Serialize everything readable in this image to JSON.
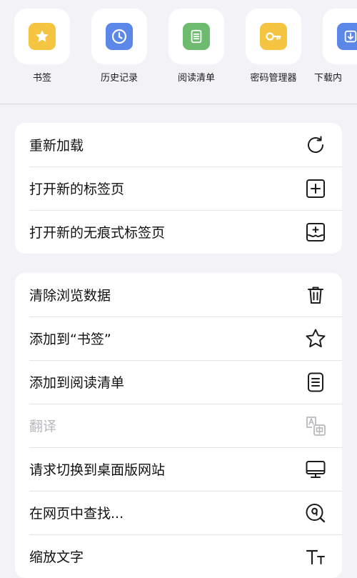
{
  "quick_actions": [
    {
      "label": "书签",
      "icon": "star-icon",
      "color": "#f5c542"
    },
    {
      "label": "历史记录",
      "icon": "clock-icon",
      "color": "#5b87e8"
    },
    {
      "label": "阅读清单",
      "icon": "reading-list-icon",
      "color": "#6dbb6f"
    },
    {
      "label": "密码管理器",
      "icon": "key-icon",
      "color": "#f5c542"
    },
    {
      "label": "下载内",
      "icon": "download-icon",
      "color": "#5b87e8"
    }
  ],
  "menu_group_1": [
    {
      "label": "重新加载",
      "icon": "reload-icon"
    },
    {
      "label": "打开新的标签页",
      "icon": "new-tab-icon"
    },
    {
      "label": "打开新的无痕式标签页",
      "icon": "incognito-tab-icon"
    }
  ],
  "menu_group_2": [
    {
      "label": "清除浏览数据",
      "icon": "trash-icon"
    },
    {
      "label": "添加到“书签”",
      "icon": "star-outline-icon"
    },
    {
      "label": "添加到阅读清单",
      "icon": "reading-list-icon"
    },
    {
      "label": "翻译",
      "icon": "translate-icon",
      "disabled": true
    },
    {
      "label": "请求切换到桌面版网站",
      "icon": "desktop-icon"
    },
    {
      "label": "在网页中查找...",
      "icon": "find-in-page-icon"
    },
    {
      "label": "缩放文字",
      "icon": "text-zoom-icon"
    }
  ],
  "colors": {
    "icon_stroke": "#1c1c1e",
    "disabled": "#b8b8bd"
  }
}
